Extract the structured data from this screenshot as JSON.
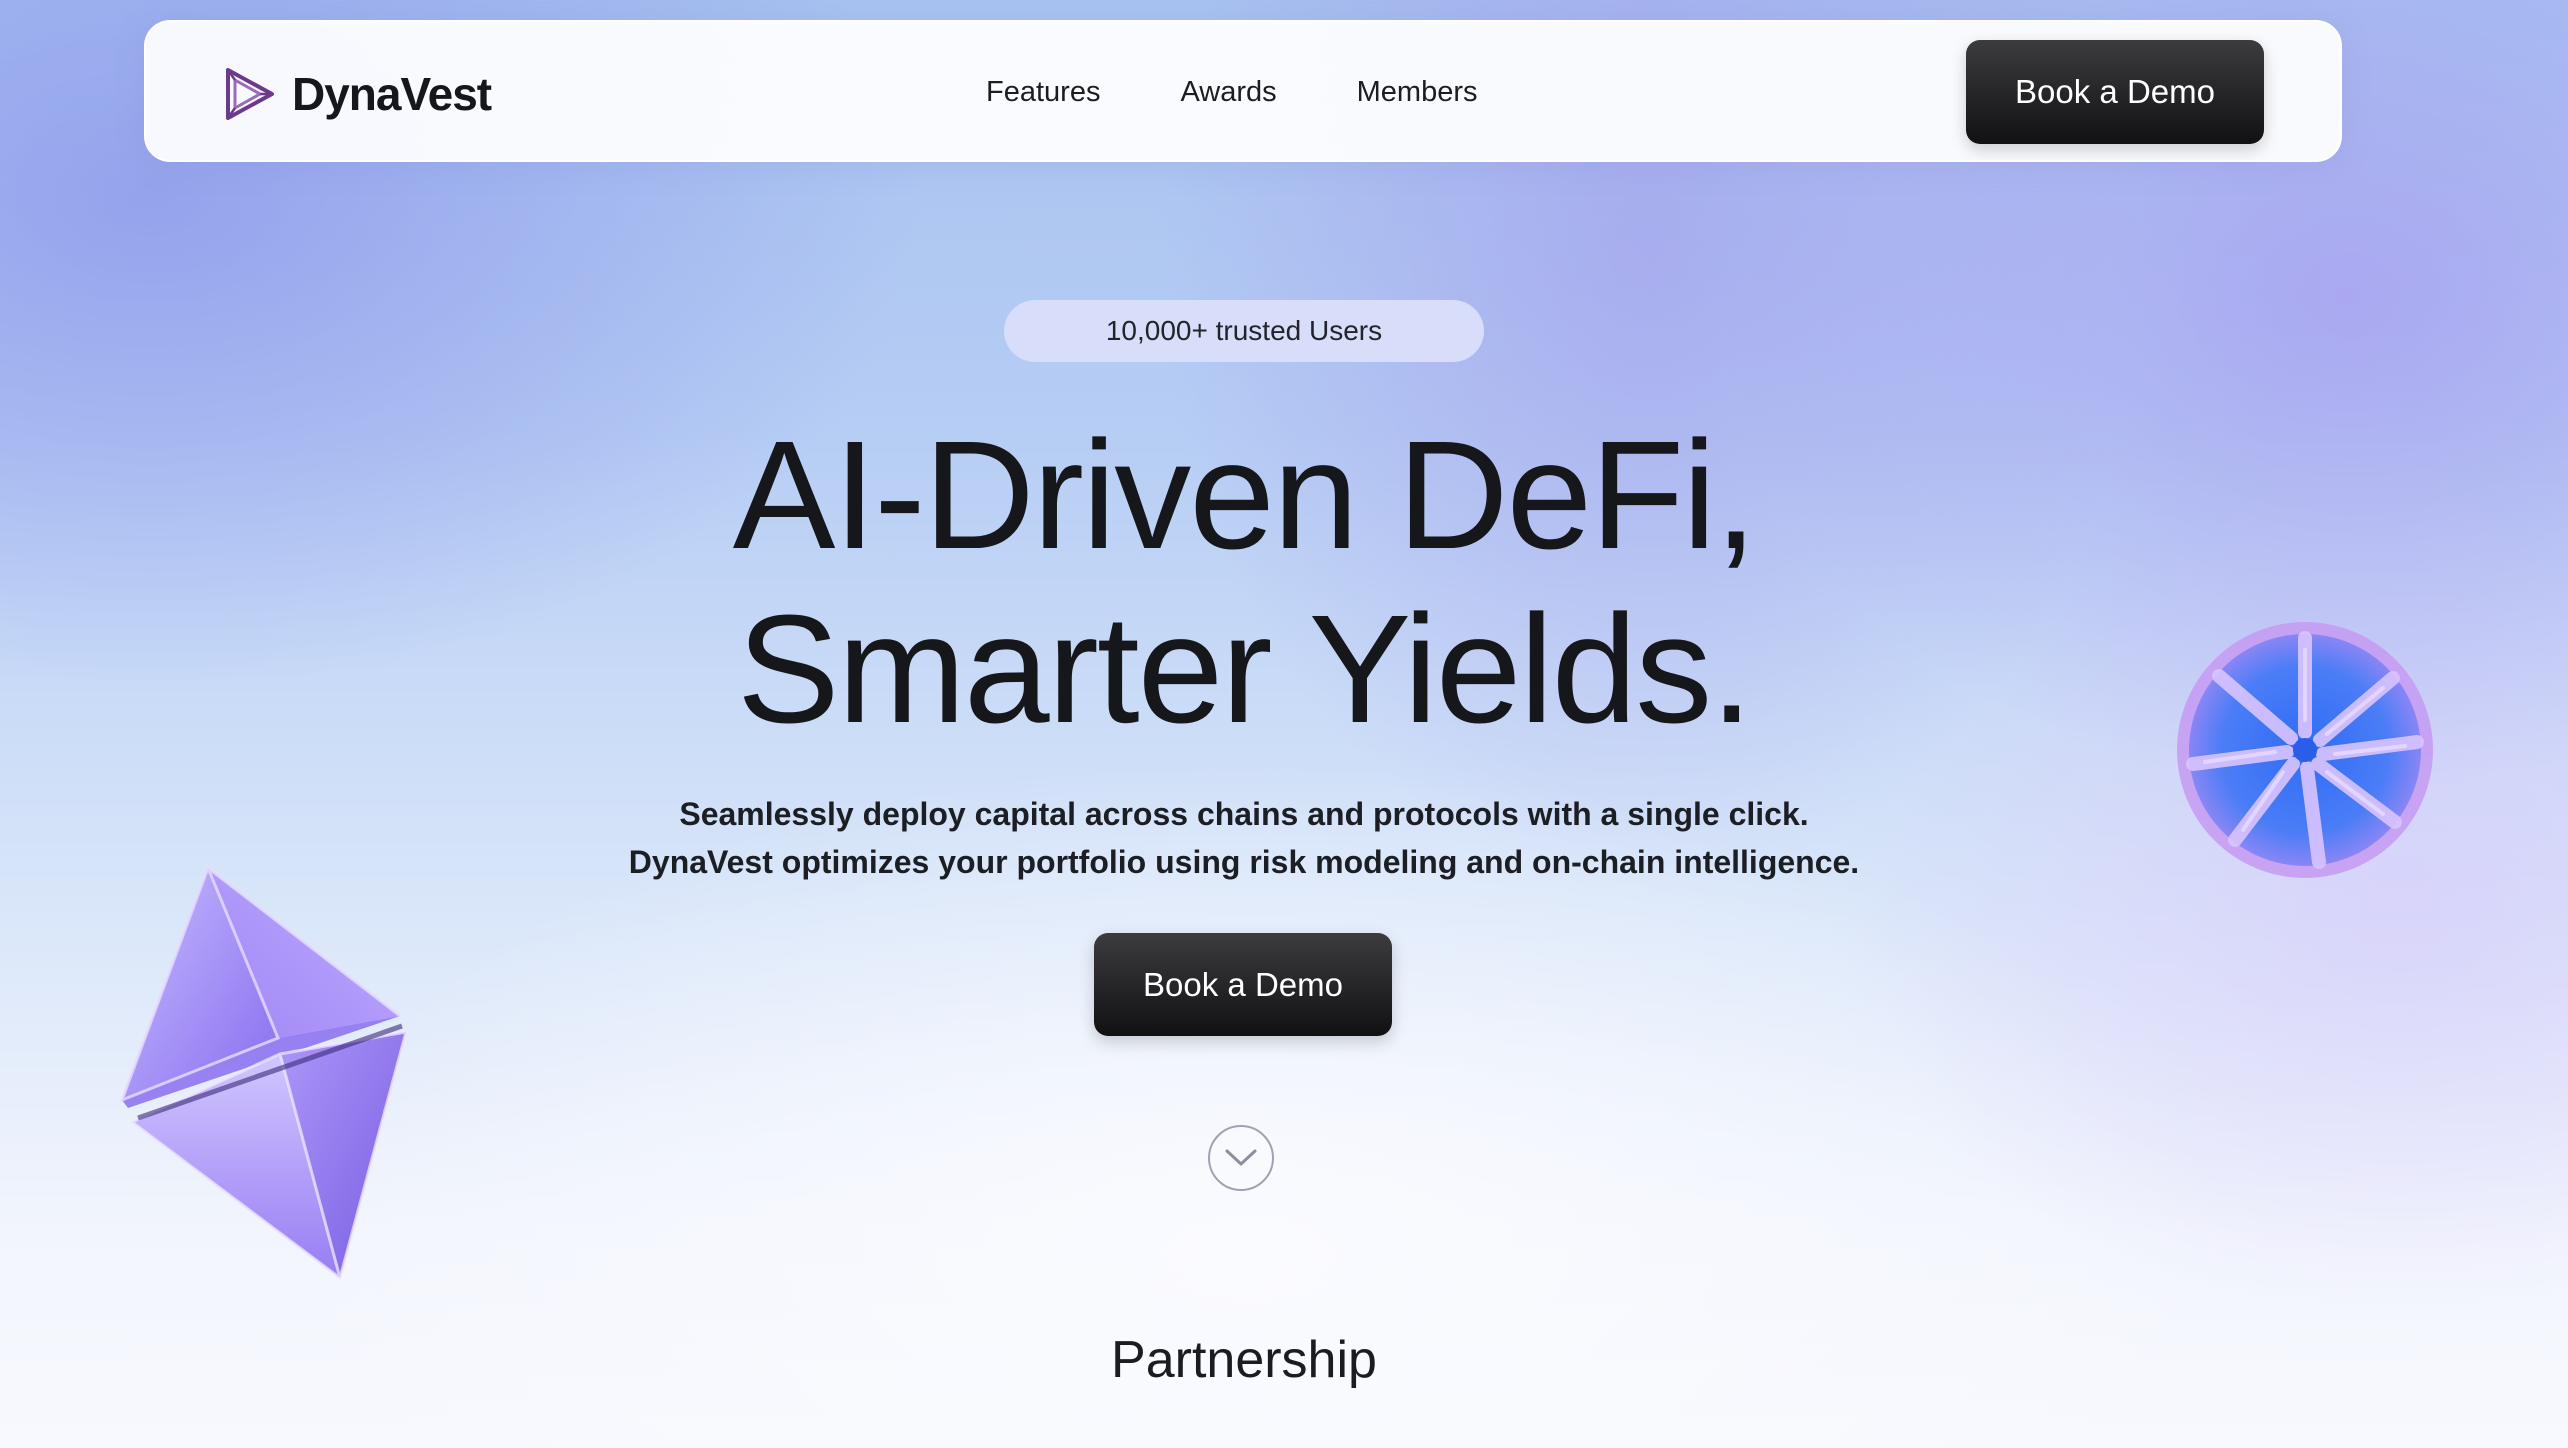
{
  "nav": {
    "brand": "DynaVest",
    "links": [
      "Features",
      "Awards",
      "Members"
    ],
    "cta_label": "Book a Demo"
  },
  "hero": {
    "badge": "10,000+ trusted Users",
    "headline_line1": "AI-Driven DeFi,",
    "headline_line2": "Smarter Yields.",
    "subtext_line1": "Seamlessly deploy capital across chains and protocols with a single click.",
    "subtext_line2": "DynaVest optimizes your portfolio using risk modeling and on-chain intelligence.",
    "cta_label": "Book a Demo"
  },
  "partnership": {
    "title": "Partnership"
  },
  "icons": {
    "logo": "play-triangle-logo-icon",
    "scroll": "chevron-down-icon",
    "left_decoration": "crystal-octahedron",
    "right_decoration": "glass-flower"
  },
  "colors": {
    "button_dark": "#111113",
    "pill_bg": "#dbe0fb",
    "logo_purple": "#6c3a8a",
    "decoration_violet": "#a98cf5",
    "decoration_blue": "#3d7cf6"
  }
}
